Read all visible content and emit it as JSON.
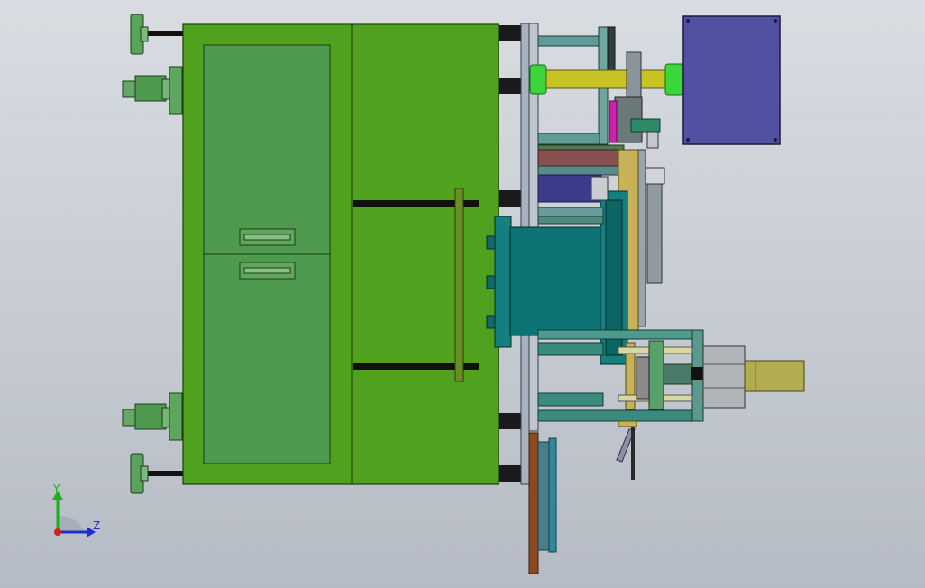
{
  "viewport": {
    "background_top": "#d9dde2",
    "background_bottom": "#b5bbc4"
  },
  "model": {
    "colors": {
      "cabinet": "#4fa11e",
      "cabinet_panel": "#4e9a4e",
      "frame": "#a8b1be",
      "shaft": "#c7c323",
      "motor_box": "#5250a3",
      "drum": "#0e7374",
      "drum_flange": "#157f80",
      "brown_plate": "#8b4a22",
      "bottom_frame": "#3a8a7d",
      "servo_motor": "#b0b3b8",
      "gearbox": "#b3ad52",
      "foot_pad": "#66a866"
    }
  },
  "triad": {
    "y_label": "Y",
    "z_label": "Z",
    "y_color": "#1fae1f",
    "z_color": "#1e2fd0",
    "origin_color": "#d0201e"
  }
}
